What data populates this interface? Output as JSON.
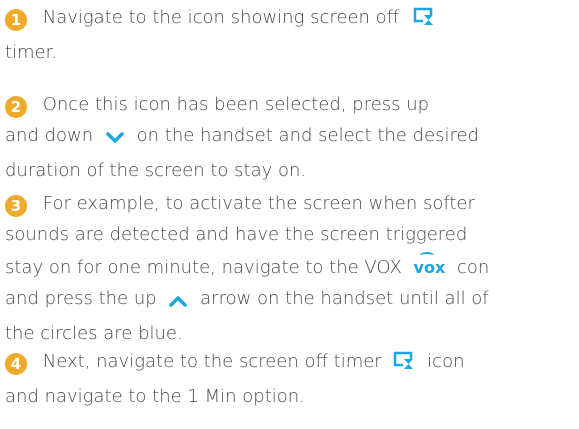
{
  "accent_color": "#1ba6e0",
  "step_number_color": "#f0aa2a",
  "steps": [
    {
      "number": "1",
      "text_a": "Navigate to the icon showing screen off",
      "text_b": "timer.",
      "icon": "screen-off-timer-icon"
    },
    {
      "number": "2",
      "text_a": "Once this icon has been selected, press up",
      "text_b": "and down",
      "text_c": "on the handset and select the desired",
      "text_d": "duration of the screen to stay on.",
      "icon": "chevron-down-icon"
    },
    {
      "number": "3",
      "text_a": "For example, to activate the screen when softer",
      "text_b": "sounds are detected and have the screen triggered",
      "text_c": "stay on for one minute, navigate to the VOX",
      "vox_label": "vox",
      "text_d": "con",
      "text_e": "and press the up",
      "text_f": "arrow on the handset until all of",
      "text_g": "the circles are blue.",
      "icons": [
        "vox-icon",
        "chevron-up-icon"
      ]
    },
    {
      "number": "4",
      "text_a": "Next, navigate to the screen off timer",
      "text_b": "icon",
      "text_c": "and navigate to the 1 Min option.",
      "icon": "screen-off-timer-icon"
    }
  ]
}
